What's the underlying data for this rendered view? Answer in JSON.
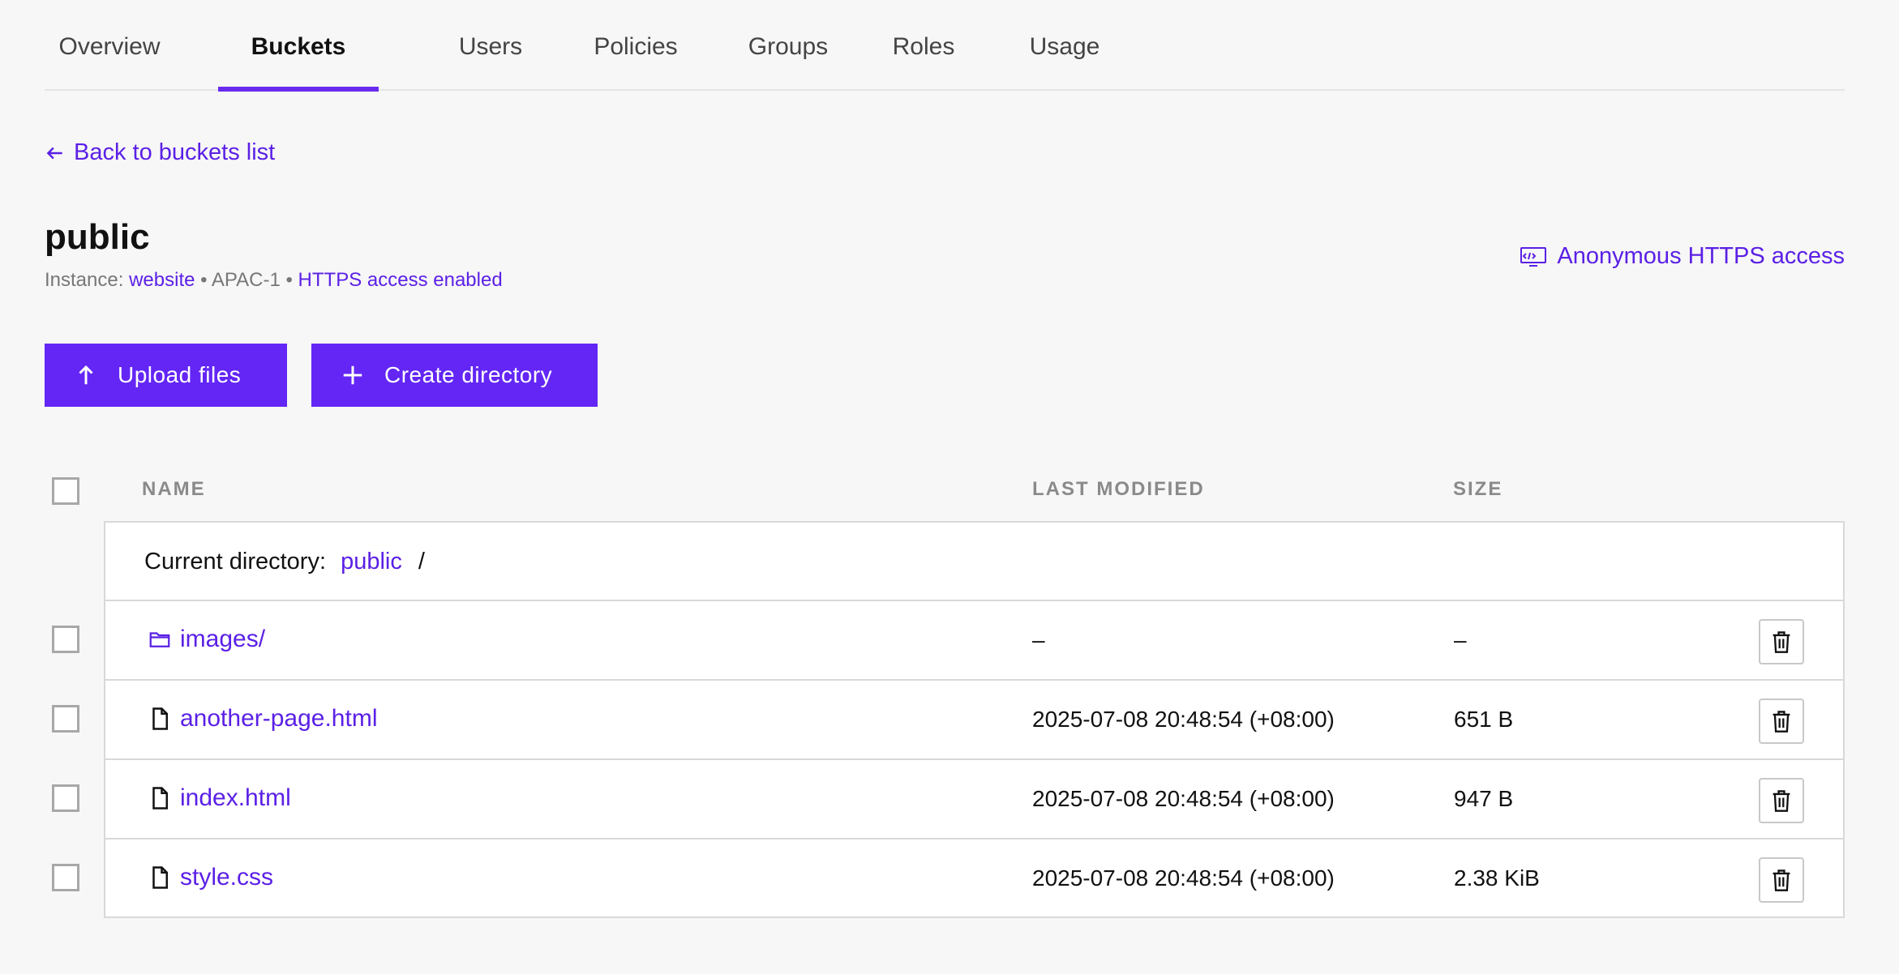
{
  "tabs": [
    {
      "label": "Overview",
      "active": false
    },
    {
      "label": "Buckets",
      "active": true
    },
    {
      "label": "Users",
      "active": false
    },
    {
      "label": "Policies",
      "active": false
    },
    {
      "label": "Groups",
      "active": false
    },
    {
      "label": "Roles",
      "active": false
    },
    {
      "label": "Usage",
      "active": false
    }
  ],
  "back_link": "Back to buckets list",
  "bucket": {
    "name": "public",
    "instance_label": "Instance:",
    "instance_value": "website",
    "separator": "•",
    "region": "APAC-1",
    "https_status": "HTTPS access enabled"
  },
  "anonymous_access_label": "Anonymous HTTPS access",
  "actions": {
    "upload_label": "Upload files",
    "create_dir_label": "Create directory"
  },
  "table": {
    "headers": {
      "name": "NAME",
      "last_modified": "LAST MODIFIED",
      "size": "SIZE"
    },
    "current_directory_label": "Current directory:",
    "current_directory_path": "public",
    "path_separator": "/",
    "rows": [
      {
        "name": "images/",
        "type": "folder",
        "last_modified": "–",
        "size": "–"
      },
      {
        "name": "another-page.html",
        "type": "file",
        "last_modified": "2025-07-08 20:48:54 (+08:00)",
        "size": "651 B"
      },
      {
        "name": "index.html",
        "type": "file",
        "last_modified": "2025-07-08 20:48:54 (+08:00)",
        "size": "947 B"
      },
      {
        "name": "style.css",
        "type": "file",
        "last_modified": "2025-07-08 20:48:54 (+08:00)",
        "size": "2.38 KiB"
      }
    ]
  },
  "icons": {
    "back": "arrow-left-icon",
    "anonymous": "code-screen-icon",
    "upload": "arrow-up-icon",
    "create": "plus-icon",
    "folder": "folder-icon",
    "file": "file-icon",
    "delete": "trash-icon"
  },
  "colors": {
    "accent": "#6326f5",
    "link": "#5b20e6",
    "background": "#f7f7f7"
  }
}
